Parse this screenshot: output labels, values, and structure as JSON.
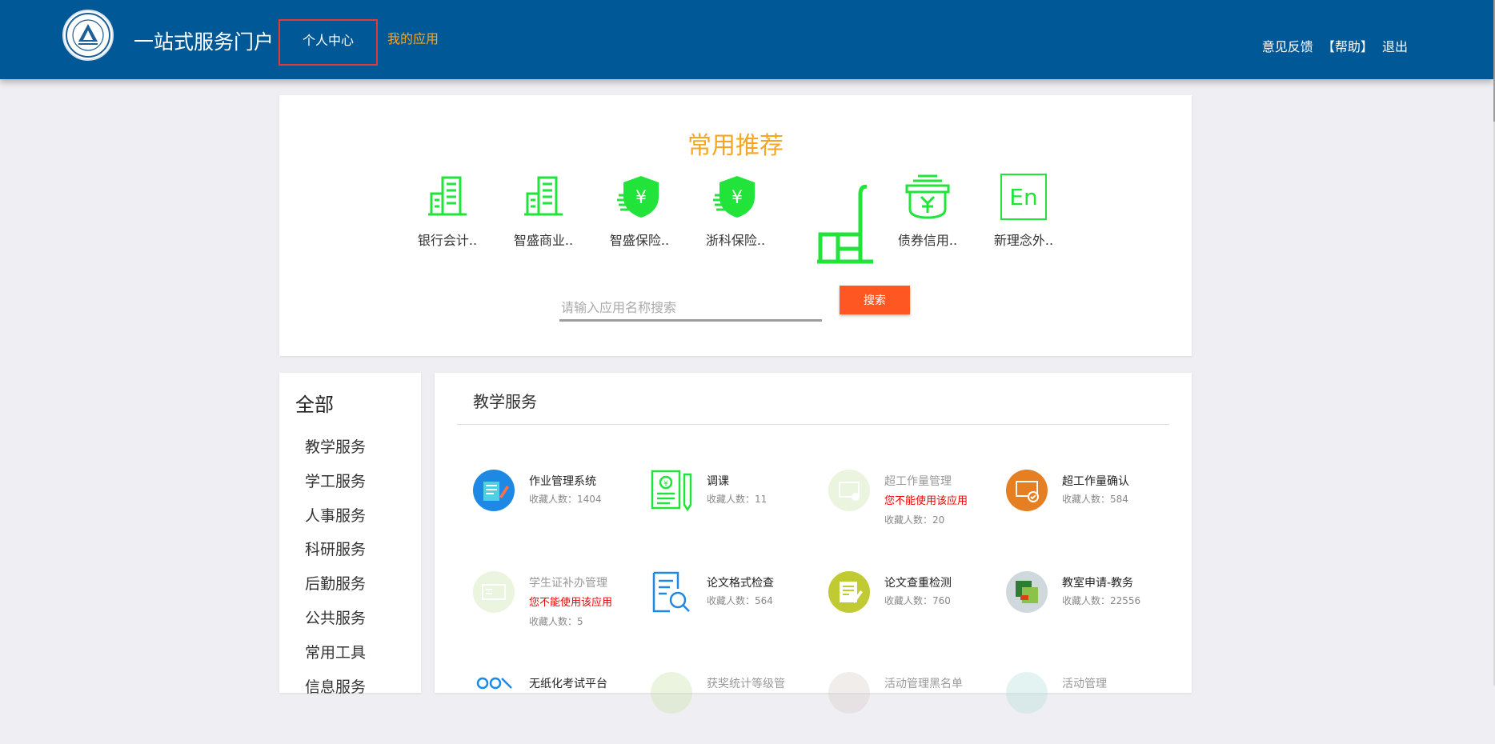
{
  "header": {
    "portal_title": "一站式服务门户",
    "nav_personal": "个人中心",
    "nav_apps": "我的应用",
    "feedback": "意见反馈",
    "help": "【帮助】",
    "logout": "退出"
  },
  "recommend": {
    "title": "常用推荐",
    "items": [
      {
        "label": "银行会计..",
        "icon": "building-icon"
      },
      {
        "label": "智盛商业..",
        "icon": "building-icon"
      },
      {
        "label": "智盛保险..",
        "icon": "shield-yen-icon"
      },
      {
        "label": "浙科保险..",
        "icon": "shield-yen-icon"
      },
      {
        "label": "债券信用..",
        "icon": "bond-yen-icon"
      },
      {
        "label": "新理念外..",
        "icon": "english-icon"
      }
    ],
    "search_placeholder": "请输入应用名称搜索",
    "search_button": "搜索"
  },
  "sidebar": {
    "title": "全部",
    "items": [
      "教学服务",
      "学工服务",
      "人事服务",
      "科研服务",
      "后勤服务",
      "公共服务",
      "常用工具",
      "信息服务"
    ]
  },
  "main": {
    "section_title": "教学服务",
    "apps": [
      {
        "name": "作业管理系统",
        "count": "收藏人数：1404"
      },
      {
        "name": "调课",
        "count": "收藏人数：11"
      },
      {
        "name": "超工作量管理",
        "warn": "您不能使用该应用",
        "count": "收藏人数：20"
      },
      {
        "name": "超工作量确认",
        "count": "收藏人数：584"
      },
      {
        "name": "学生证补办管理",
        "warn": "您不能使用该应用",
        "count": "收藏人数：5"
      },
      {
        "name": "论文格式检查",
        "count": "收藏人数：564"
      },
      {
        "name": "论文查重检测",
        "count": "收藏人数：760"
      },
      {
        "name": "教室申请-教务",
        "count": "收藏人数：22556"
      },
      {
        "name": "无纸化考试平台"
      },
      {
        "name": "获奖统计等级管"
      },
      {
        "name": "活动管理黑名单"
      },
      {
        "name": "活动管理"
      }
    ]
  },
  "colors": {
    "header_bg": "#005996",
    "accent_orange": "#f5a623",
    "search_button": "#ff5722",
    "icon_green": "#22e33a",
    "warning_red": "#e00000"
  }
}
